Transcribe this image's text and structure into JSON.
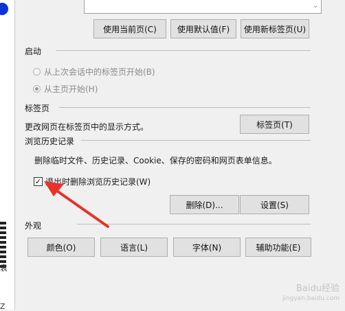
{
  "homepage": {
    "use_current_label": "使用当前页(C)",
    "use_default_label": "使用默认值(F)",
    "use_new_tab_label": "使用新标签页(U)"
  },
  "startup": {
    "title": "启动",
    "options": [
      {
        "label": "从上次会话中的标签页开始(B)",
        "selected": false
      },
      {
        "label": "从主页开始(H)",
        "selected": true
      }
    ]
  },
  "tabs": {
    "title": "标签页",
    "description": "更改网页在标签页中的显示方式。",
    "button_label": "标签页(T)"
  },
  "history": {
    "title": "浏览历史记录",
    "description": "删除临时文件、历史记录、Cookie、保存的密码和网页表单信息。",
    "checkbox_label": "退出时删除浏览历史记录(W)",
    "checkbox_checked": true,
    "delete_label": "删除(D)...",
    "settings_label": "设置(S)"
  },
  "appearance": {
    "title": "外观",
    "colors_label": "颜色(O)",
    "languages_label": "语言(L)",
    "fonts_label": "字体(N)",
    "accessibility_label": "辅助功能(E)"
  },
  "background_left": {
    "char_1": "袁",
    "char_2": "Z"
  },
  "watermark": {
    "line1": "Baidu经验",
    "line2": "jingyan.baidu.com"
  },
  "annotation": {
    "arrow_color": "#e8322b"
  }
}
